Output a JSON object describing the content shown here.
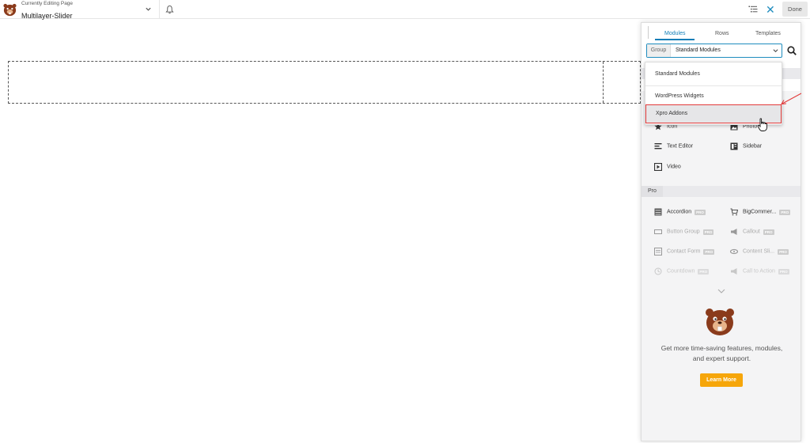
{
  "topbar": {
    "editing_label": "Currently Editing Page",
    "page_title": "Multilayer-Slider",
    "done_label": "Done",
    "close_glyph": "✕"
  },
  "panel": {
    "tabs": [
      {
        "label": "Modules",
        "active": true
      },
      {
        "label": "Rows",
        "active": false
      },
      {
        "label": "Templates",
        "active": false
      }
    ],
    "group": {
      "label": "Group",
      "selected": "Standard Modules"
    },
    "standard_modules": [
      {
        "label": "Icon",
        "icon": "star-icon"
      },
      {
        "label": "Photo",
        "icon": "photo-icon"
      },
      {
        "label": "Text Editor",
        "icon": "text-editor-icon"
      },
      {
        "label": "Sidebar",
        "icon": "sidebar-icon"
      },
      {
        "label": "Video",
        "icon": "video-icon"
      }
    ],
    "pro_section": {
      "label": "Pro",
      "badge": "PRO",
      "modules": [
        {
          "label": "Accordion",
          "icon": "accordion-icon"
        },
        {
          "label": "BigCommer...",
          "icon": "cart-icon"
        },
        {
          "label": "Button Group",
          "icon": "button-group-icon"
        },
        {
          "label": "Callout",
          "icon": "megaphone-icon"
        },
        {
          "label": "Contact Form",
          "icon": "form-icon"
        },
        {
          "label": "Content Sli...",
          "icon": "slider-icon"
        },
        {
          "label": "Countdown",
          "icon": "clock-icon"
        },
        {
          "label": "Call to Action",
          "icon": "megaphone-icon"
        }
      ]
    },
    "promo": {
      "text": "Get more time-saving features, modules, and expert support.",
      "button": "Learn More"
    }
  },
  "dropdown": {
    "options": [
      "Standard Modules",
      "WordPress Widgets",
      "Xpro Addons"
    ],
    "highlighted": "Xpro Addons"
  },
  "colors": {
    "accent": "#0e7db7",
    "learn_more": "#f6a60a",
    "highlight_border": "#e23a3a"
  }
}
